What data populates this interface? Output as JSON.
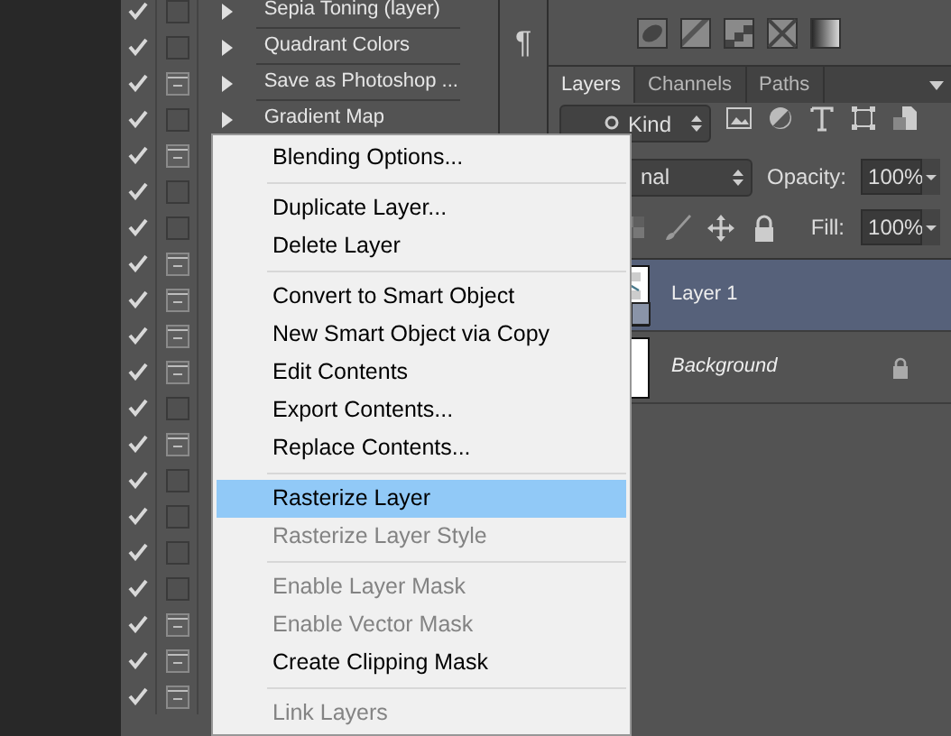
{
  "actions": {
    "rows": [
      {
        "name": "Sepia Toning (layer)",
        "checked": true,
        "dialog": false
      },
      {
        "name": "Quadrant Colors",
        "checked": true,
        "dialog": false
      },
      {
        "name": "Save as Photoshop ...",
        "checked": true,
        "dialog": true
      },
      {
        "name": "Gradient Map",
        "checked": true,
        "dialog": false
      },
      {
        "checked": true,
        "dialog": true
      },
      {
        "checked": true,
        "dialog": false
      },
      {
        "checked": true,
        "dialog": false
      },
      {
        "checked": true,
        "dialog": true
      },
      {
        "checked": true,
        "dialog": true
      },
      {
        "checked": true,
        "dialog": true
      },
      {
        "checked": true,
        "dialog": true
      },
      {
        "checked": true,
        "dialog": false
      },
      {
        "checked": true,
        "dialog": true
      },
      {
        "checked": true,
        "dialog": false
      },
      {
        "checked": true,
        "dialog": false
      },
      {
        "checked": true,
        "dialog": false
      },
      {
        "checked": true,
        "dialog": false
      },
      {
        "checked": true,
        "dialog": true
      },
      {
        "checked": true,
        "dialog": true
      },
      {
        "checked": true,
        "dialog": true
      }
    ]
  },
  "dock": {
    "glyph": "¶"
  },
  "layers_panel": {
    "tabs": [
      {
        "label": "Layers",
        "selected": true
      },
      {
        "label": "Channels",
        "selected": false
      },
      {
        "label": "Paths",
        "selected": false
      }
    ],
    "filter": {
      "value": "Kind"
    },
    "blend_mode": {
      "value": "nal"
    },
    "opacity": {
      "label": "Opacity:",
      "value": "100%"
    },
    "fill": {
      "label": "Fill:",
      "value": "100%"
    },
    "layers": [
      {
        "name": "Layer 1",
        "kind": "smart",
        "selected": true
      },
      {
        "name": "Background",
        "kind": "background",
        "selected": false
      }
    ]
  },
  "context_menu": {
    "items": [
      {
        "kind": "item",
        "label": "Blending Options...",
        "disabled": false,
        "selected": false
      },
      {
        "kind": "separator"
      },
      {
        "kind": "item",
        "label": "Duplicate Layer...",
        "disabled": false,
        "selected": false
      },
      {
        "kind": "item",
        "label": "Delete Layer",
        "disabled": false,
        "selected": false
      },
      {
        "kind": "separator"
      },
      {
        "kind": "item",
        "label": "Convert to Smart Object",
        "disabled": false,
        "selected": false
      },
      {
        "kind": "item",
        "label": "New Smart Object via Copy",
        "disabled": false,
        "selected": false
      },
      {
        "kind": "item",
        "label": "Edit Contents",
        "disabled": false,
        "selected": false
      },
      {
        "kind": "item",
        "label": "Export Contents...",
        "disabled": false,
        "selected": false
      },
      {
        "kind": "item",
        "label": "Replace Contents...",
        "disabled": false,
        "selected": false
      },
      {
        "kind": "separator"
      },
      {
        "kind": "item",
        "label": "Rasterize Layer",
        "disabled": false,
        "selected": true
      },
      {
        "kind": "item",
        "label": "Rasterize Layer Style",
        "disabled": true,
        "selected": false
      },
      {
        "kind": "separator"
      },
      {
        "kind": "item",
        "label": "Enable Layer Mask",
        "disabled": true,
        "selected": false
      },
      {
        "kind": "item",
        "label": "Enable Vector Mask",
        "disabled": true,
        "selected": false
      },
      {
        "kind": "item",
        "label": "Create Clipping Mask",
        "disabled": false,
        "selected": false
      },
      {
        "kind": "separator"
      },
      {
        "kind": "item",
        "label": "Link Layers",
        "disabled": true,
        "selected": false
      }
    ]
  }
}
